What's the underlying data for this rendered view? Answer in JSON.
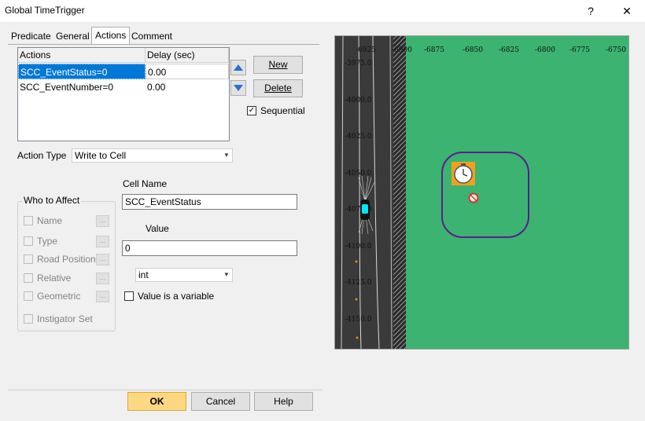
{
  "window": {
    "title": "Global TimeTrigger",
    "help_label": "?",
    "close_label": "✕"
  },
  "tabs": [
    {
      "label": "Predicate"
    },
    {
      "label": "General"
    },
    {
      "label": "Actions"
    },
    {
      "label": "Comment"
    }
  ],
  "actions_table": {
    "headers": [
      "Actions",
      "Delay (sec)"
    ],
    "rows": [
      {
        "action": "SCC_EventStatus=0",
        "delay": "0.00"
      },
      {
        "action": "SCC_EventNumber=0",
        "delay": "0.00"
      }
    ]
  },
  "buttons": {
    "new": "New",
    "delete": "Delete",
    "ok": "OK",
    "cancel": "Cancel",
    "help": "Help"
  },
  "sequential": {
    "label": "Sequential",
    "checked": true
  },
  "action_type": {
    "label": "Action Type",
    "value": "Write to Cell"
  },
  "who_to_affect": {
    "title": "Who to Affect",
    "items": [
      {
        "label": "Name"
      },
      {
        "label": "Type"
      },
      {
        "label": "Road Position"
      },
      {
        "label": "Relative"
      },
      {
        "label": "Geometric"
      }
    ],
    "instigator": "Instigator Set",
    "ellipsis": "..."
  },
  "cell_name": {
    "label": "Cell Name",
    "value": "SCC_EventStatus"
  },
  "value_field": {
    "label": "Value",
    "value": "0"
  },
  "value_type": {
    "value": "int"
  },
  "value_is_variable": {
    "label": "Value is a variable",
    "checked": false
  },
  "map": {
    "x_ticks": [
      "-6925",
      "-6900",
      "-6875",
      "-6850",
      "-6825",
      "-6800",
      "-6775",
      "-6750"
    ],
    "y_ticks": [
      "-3975.0",
      "-4000.0",
      "-4025.0",
      "-4050.0",
      "-4075.0",
      "-4100.0",
      "-4125.0",
      "-4150.0"
    ],
    "colors": {
      "grass": "#3cb371",
      "road": "#3a3a3a",
      "trigger_outline": "#5a1e8c"
    }
  }
}
